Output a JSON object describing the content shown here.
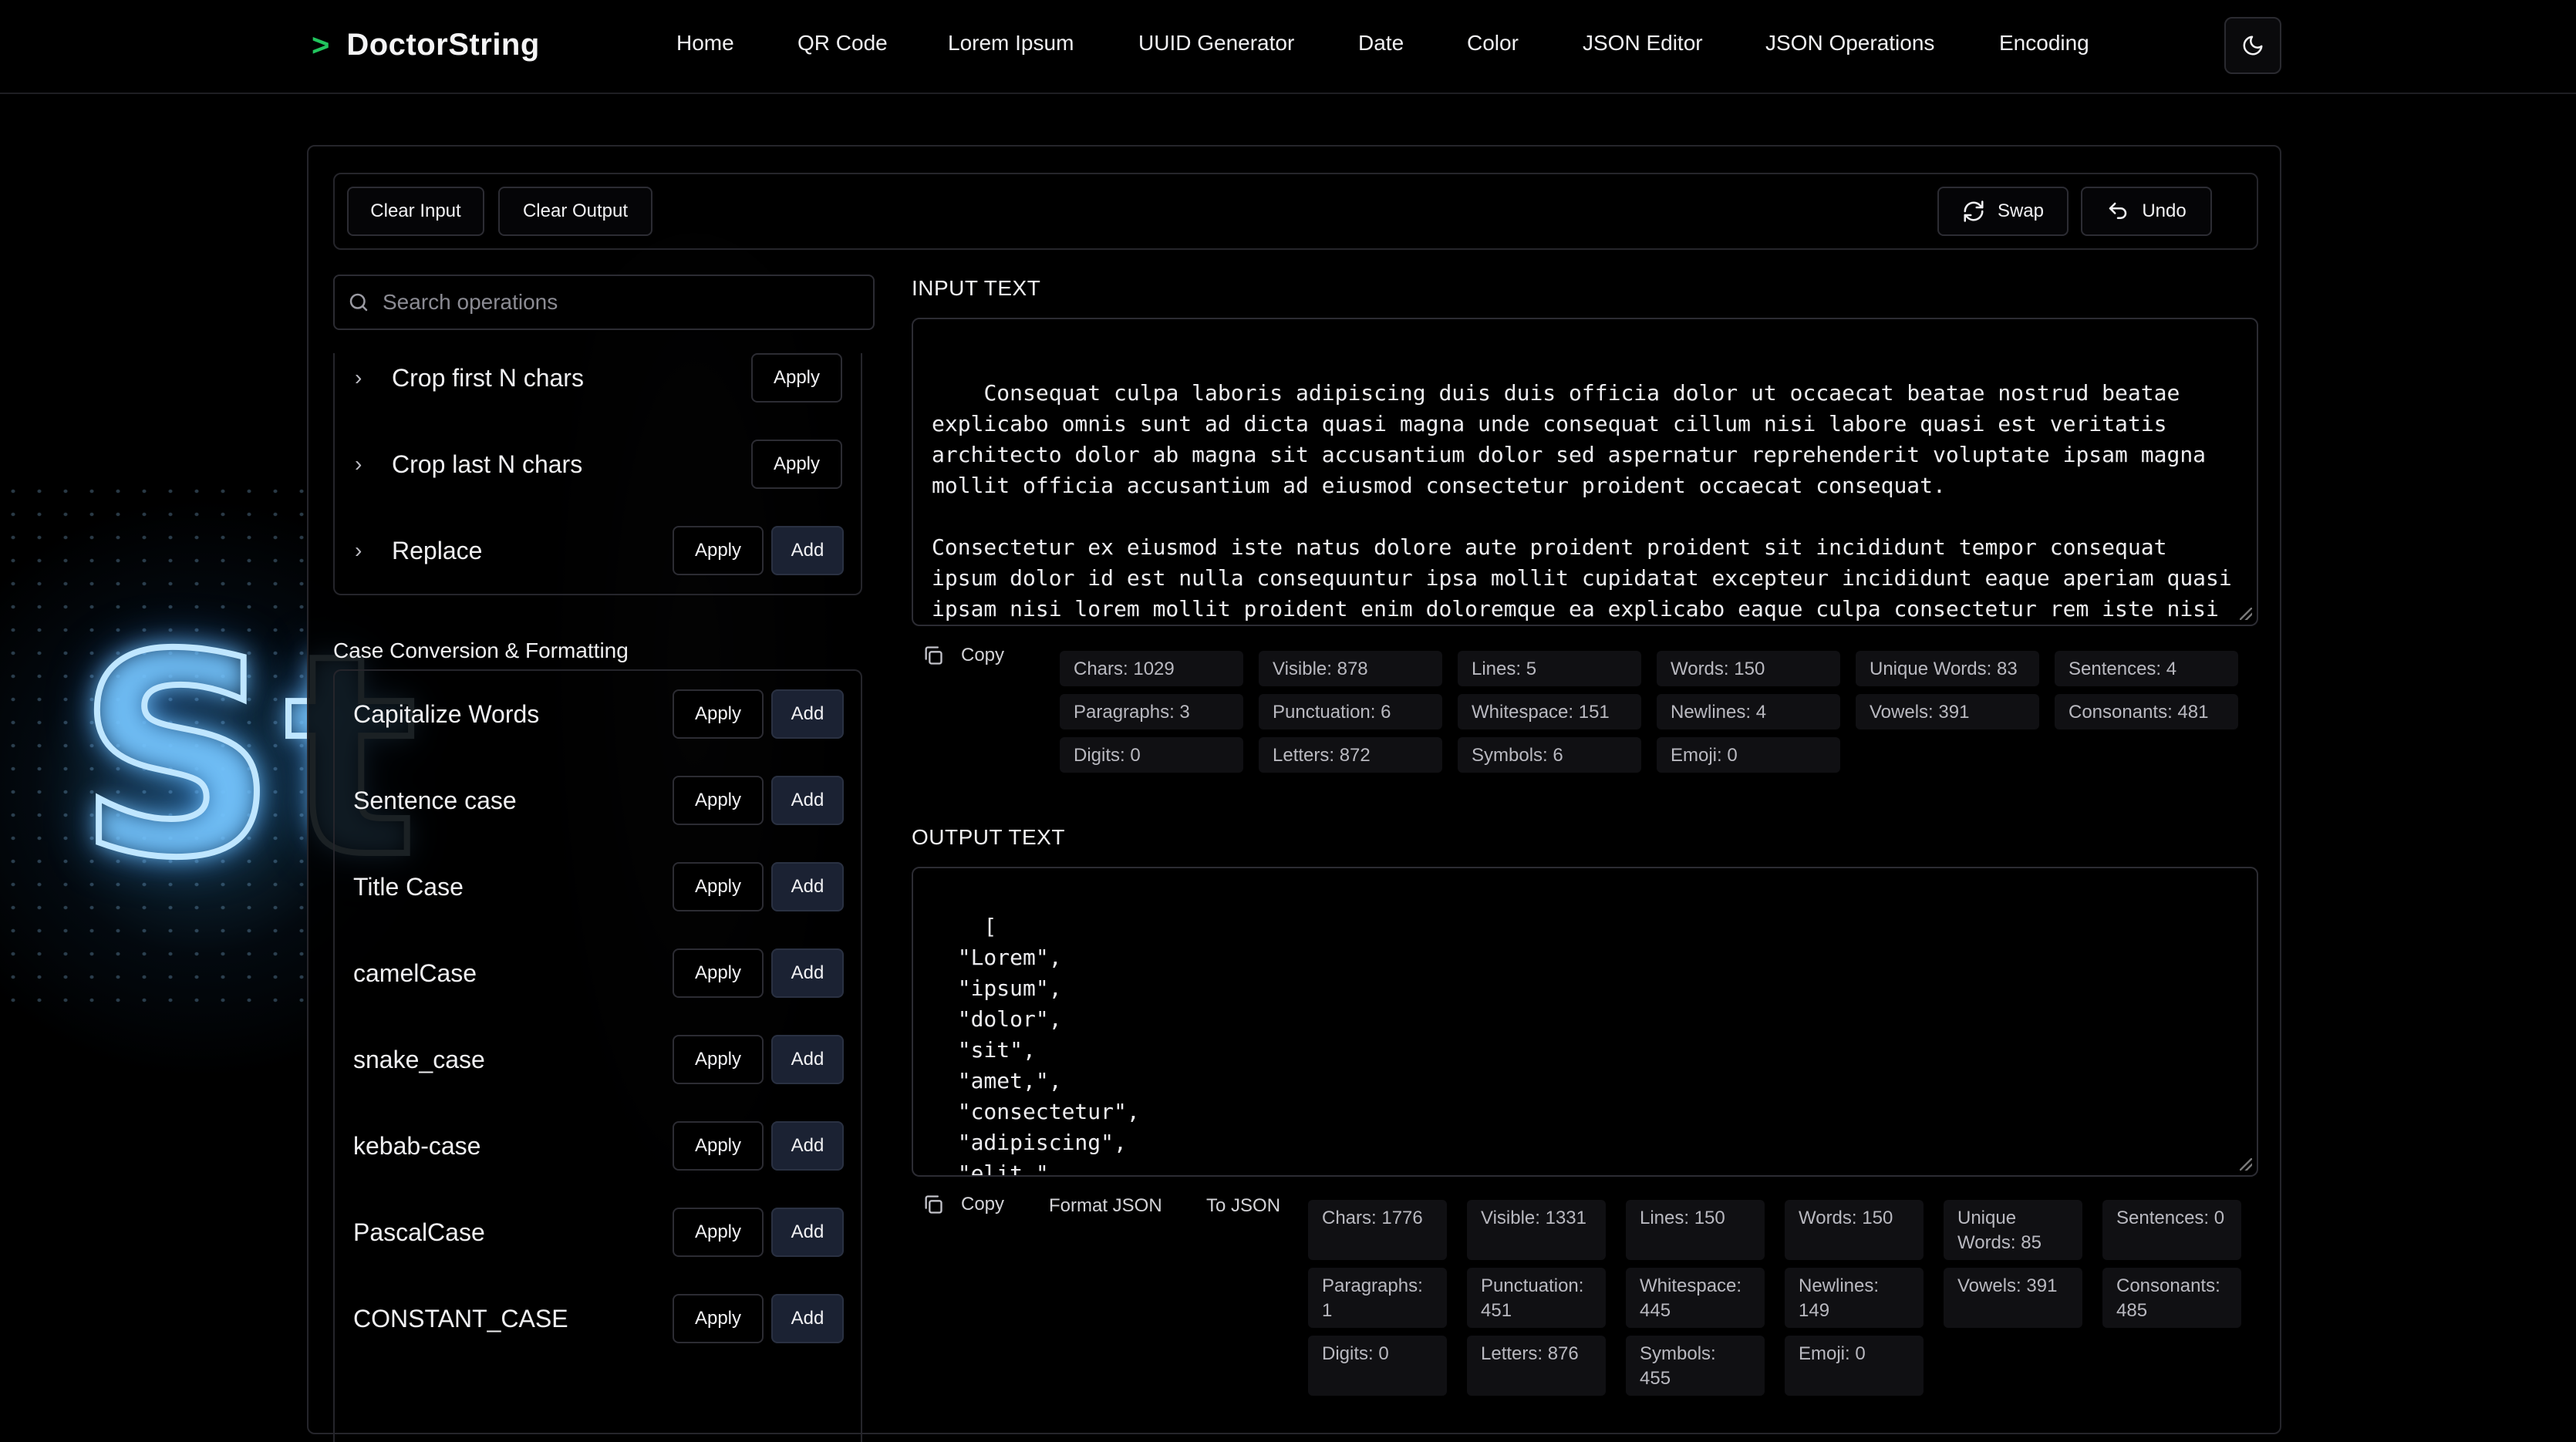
{
  "brand": {
    "chevron": ">",
    "name": "DoctorString"
  },
  "nav": [
    "Home",
    "QR Code",
    "Lorem Ipsum",
    "UUID Generator",
    "Date",
    "Color",
    "JSON Editor",
    "JSON Operations",
    "Encoding"
  ],
  "theme_toggle_icon": "moon-icon",
  "toolbar": {
    "clear_input": "Clear Input",
    "clear_output": "Clear Output",
    "swap": "Swap",
    "undo": "Undo"
  },
  "search": {
    "placeholder": "Search operations",
    "value": ""
  },
  "ops_top": [
    {
      "label": "Crop first N chars",
      "apply": "Apply"
    },
    {
      "label": "Crop last N chars",
      "apply": "Apply"
    },
    {
      "label": "Replace",
      "apply": "Apply",
      "add": "Add"
    }
  ],
  "case_section": {
    "title": "Case Conversion & Formatting",
    "items": [
      {
        "label": "Capitalize Words",
        "apply": "Apply",
        "add": "Add"
      },
      {
        "label": "Sentence case",
        "apply": "Apply",
        "add": "Add"
      },
      {
        "label": "Title Case",
        "apply": "Apply",
        "add": "Add"
      },
      {
        "label": "camelCase",
        "apply": "Apply",
        "add": "Add"
      },
      {
        "label": "snake_case",
        "apply": "Apply",
        "add": "Add"
      },
      {
        "label": "kebab-case",
        "apply": "Apply",
        "add": "Add"
      },
      {
        "label": "PascalCase",
        "apply": "Apply",
        "add": "Add"
      },
      {
        "label": "CONSTANT_CASE",
        "apply": "Apply",
        "add": "Add"
      }
    ]
  },
  "input": {
    "label": "INPUT TEXT",
    "text": "Consequat culpa laboris adipiscing duis duis officia dolor ut occaecat beatae nostrud beatae\nexplicabo omnis sunt ad dicta quasi magna unde consequat cillum nisi labore quasi est veritatis\narchitecto dolor ab magna sit accusantium dolor sed aspernatur reprehenderit voluptate ipsam magna\nmollit officia accusantium ad eiusmod consectetur proident occaecat consequat.\n\nConsectetur ex eiusmod iste natus dolore aute proident proident sit incididunt tempor consequat\nipsum dolor id est nulla consequuntur ipsa mollit cupidatat excepteur incididunt eaque aperiam quasi\nipsam nisi lorem mollit proident enim doloremque ea explicabo eaque culpa consectetur rem iste nisi\nodit ad perspiciatis sint deserunt et ullamco laboris.",
    "copy": "Copy",
    "stats": [
      "Chars: 1029",
      "Visible: 878",
      "Lines: 5",
      "Words: 150",
      "Unique Words: 83",
      "Sentences: 4",
      "Paragraphs: 3",
      "Punctuation: 6",
      "Whitespace: 151",
      "Newlines: 4",
      "Vowels: 391",
      "Consonants: 481",
      "Digits: 0",
      "Letters: 872",
      "Symbols: 6",
      "Emoji: 0"
    ]
  },
  "output": {
    "label": "OUTPUT TEXT",
    "text": "[\n  \"Lorem\",\n  \"ipsum\",\n  \"dolor\",\n  \"sit\",\n  \"amet,\",\n  \"consectetur\",\n  \"adipiscing\",\n  \"elit,\",\n  \"sed\",",
    "copy": "Copy",
    "format_json": "Format JSON",
    "to_json": "To JSON",
    "stats": [
      "Chars: 1776",
      "Visible: 1331",
      "Lines: 150",
      "Words: 150",
      "Unique Words: 85",
      "Sentences: 0",
      "Paragraphs: 1",
      "Punctuation: 451",
      "Whitespace: 445",
      "Newlines: 149",
      "Vowels: 391",
      "Consonants: 485",
      "Digits: 0",
      "Letters: 876",
      "Symbols: 455",
      "Emoji: 0"
    ]
  },
  "colors": {
    "accent": "#22c55e",
    "add_button": "#1b2233",
    "background": "#000000"
  }
}
